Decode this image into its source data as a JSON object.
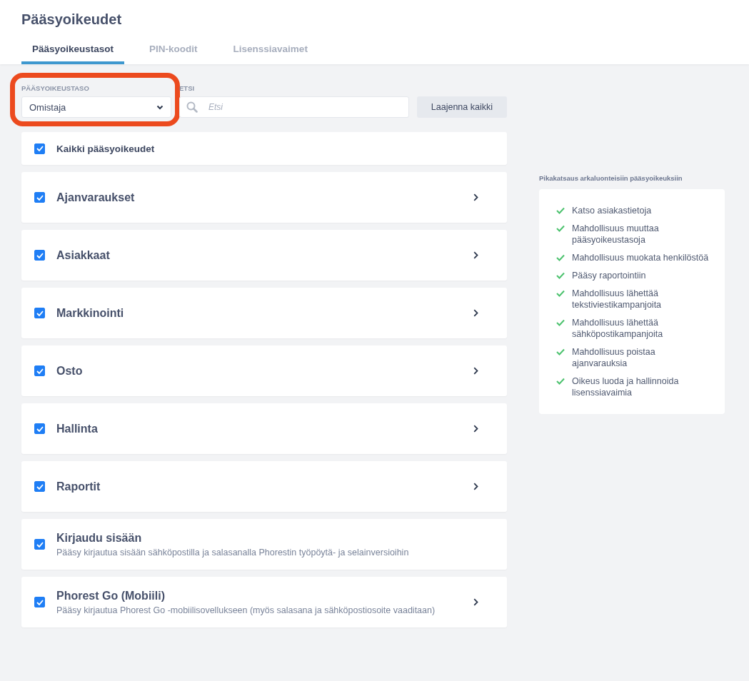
{
  "title": "Pääsyoikeudet",
  "tabs": [
    {
      "label": "Pääsyoikeustasot",
      "selected": true
    },
    {
      "label": "PIN-koodit",
      "selected": false
    },
    {
      "label": "Lisenssiavaimet",
      "selected": false
    }
  ],
  "level_select": {
    "label": "PÄÄSYOIKEUSTASO",
    "value": "Omistaja",
    "highlighted": true
  },
  "search": {
    "label": "ETSI",
    "placeholder": "Etsi"
  },
  "expand_button": "Laajenna kaikki",
  "all_permissions": {
    "label": "Kaikki pääsyoikeudet",
    "checked": true
  },
  "permissions": [
    {
      "name": "Ajanvaraukset",
      "checked": true,
      "expandable": true
    },
    {
      "name": "Asiakkaat",
      "checked": true,
      "expandable": true
    },
    {
      "name": "Markkinointi",
      "checked": true,
      "expandable": true
    },
    {
      "name": "Osto",
      "checked": true,
      "expandable": true
    },
    {
      "name": "Hallinta",
      "checked": true,
      "expandable": true
    },
    {
      "name": "Raportit",
      "checked": true,
      "expandable": true
    },
    {
      "name": "Kirjaudu sisään",
      "description": "Pääsy kirjautua sisään sähköpostilla ja salasanalla Phorestin työpöytä- ja selainversioihin",
      "checked": true,
      "expandable": false
    },
    {
      "name": "Phorest Go (Mobiili)",
      "description": "Pääsy kirjautua Phorest Go -mobiilisovellukseen (myös salasana ja sähköpostiosoite vaaditaan)",
      "checked": true,
      "expandable": true
    }
  ],
  "overview": {
    "title": "Pikakatsaus arkaluonteisiin pääsyoikeuksiin",
    "items": [
      "Katso asiakastietoja",
      "Mahdollisuus muuttaa pääsyoikeustasoja",
      "Mahdollisuus muokata henkilöstöä",
      "Pääsy raportointiin",
      "Mahdollisuus lähettää tekstiviestikampanjoita",
      "Mahdollisuus lähettää sähköpostikampanjoita",
      "Mahdollisuus poistaa ajanvarauksia",
      "Oikeus luoda ja hallinnoida lisenssiavaimia"
    ]
  }
}
